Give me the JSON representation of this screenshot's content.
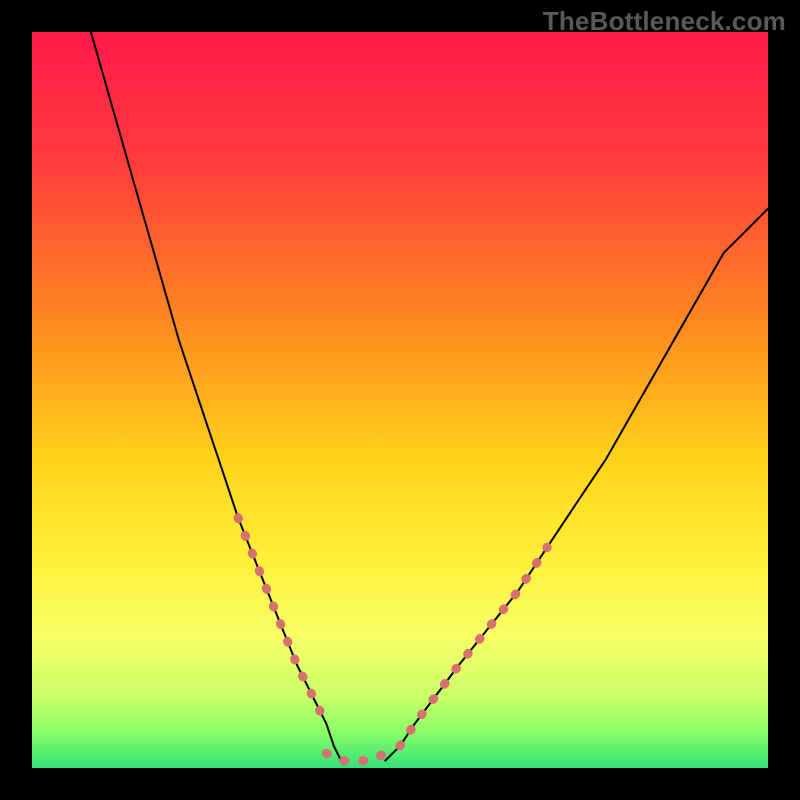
{
  "watermark": "TheBottleneck.com",
  "chart_data": {
    "type": "line",
    "title": "",
    "xlabel": "",
    "ylabel": "",
    "xlim": [
      0,
      100
    ],
    "ylim": [
      0,
      100
    ],
    "grid": false,
    "legend": false,
    "gradient_stops": [
      {
        "pos": 0.0,
        "color": "#ff1a4b"
      },
      {
        "pos": 0.18,
        "color": "#ff3d3d"
      },
      {
        "pos": 0.4,
        "color": "#ff8a1f"
      },
      {
        "pos": 0.58,
        "color": "#ffd21a"
      },
      {
        "pos": 0.72,
        "color": "#fff03a"
      },
      {
        "pos": 0.82,
        "color": "#f6ff66"
      },
      {
        "pos": 0.9,
        "color": "#ccff66"
      },
      {
        "pos": 0.95,
        "color": "#8cff66"
      },
      {
        "pos": 1.0,
        "color": "#33e07a"
      }
    ],
    "series": [
      {
        "name": "curve-left",
        "stroke": "#000000",
        "stroke_width": 2,
        "x": [
          8,
          10,
          12,
          14,
          16,
          18,
          20,
          22,
          24,
          26,
          28,
          30,
          32,
          34,
          36,
          38,
          40,
          41,
          42
        ],
        "y": [
          100,
          93,
          86,
          79,
          72,
          65,
          58,
          52,
          46,
          40,
          34,
          29,
          24,
          19,
          14,
          10,
          6,
          3,
          1
        ]
      },
      {
        "name": "curve-right",
        "stroke": "#000000",
        "stroke_width": 2,
        "x": [
          48,
          50,
          52,
          55,
          58,
          62,
          66,
          70,
          74,
          78,
          82,
          86,
          90,
          94,
          98,
          100
        ],
        "y": [
          1,
          3,
          6,
          10,
          14,
          19,
          24,
          30,
          36,
          42,
          49,
          56,
          63,
          70,
          74,
          76
        ]
      },
      {
        "name": "highlight-left",
        "stroke": "#d87070",
        "stroke_width": 9,
        "x": [
          28,
          30,
          32,
          34,
          36,
          38,
          40
        ],
        "y": [
          34,
          29,
          24,
          19,
          14,
          10,
          6
        ]
      },
      {
        "name": "highlight-right",
        "stroke": "#d87070",
        "stroke_width": 9,
        "x": [
          50,
          52,
          55,
          58,
          62,
          66,
          70
        ],
        "y": [
          3,
          6,
          10,
          14,
          19,
          24,
          30
        ]
      },
      {
        "name": "valley-floor",
        "stroke": "#d87070",
        "stroke_width": 9,
        "x": [
          40,
          42,
          44,
          46,
          48
        ],
        "y": [
          2,
          1,
          1,
          1,
          2
        ]
      }
    ]
  }
}
